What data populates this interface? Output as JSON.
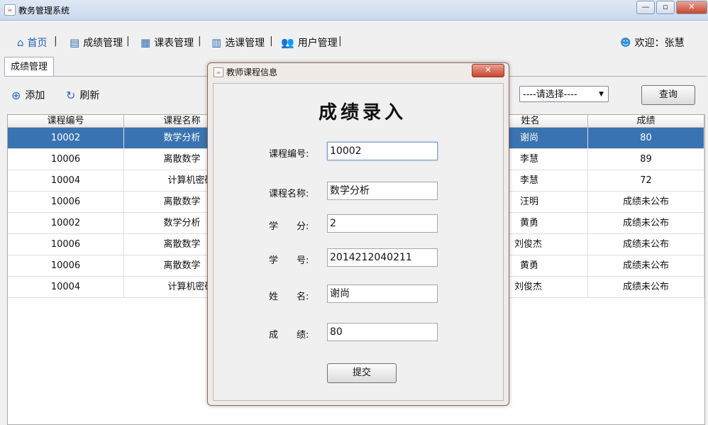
{
  "window": {
    "title": "教务管理系统"
  },
  "menu": {
    "items": [
      {
        "label": "首页",
        "icon": "home-icon"
      },
      {
        "label": "成绩管理",
        "icon": "document-icon"
      },
      {
        "label": "课表管理",
        "icon": "calendar-icon"
      },
      {
        "label": "选课管理",
        "icon": "books-icon"
      },
      {
        "label": "用户管理",
        "icon": "users-icon"
      }
    ],
    "separator": "|",
    "welcome": "欢迎：张慧"
  },
  "tabs": [
    {
      "label": "成绩管理"
    }
  ],
  "toolbar": {
    "add_label": "添加",
    "refresh_label": "刷新",
    "filter_value": "----请选择----",
    "query_label": "查询"
  },
  "table": {
    "headers": [
      "课程编号",
      "课程名称",
      "姓名",
      "成绩"
    ],
    "rows": [
      [
        "10002",
        "数学分析",
        "谢尚",
        "80"
      ],
      [
        "10006",
        "离散数学",
        "李慧",
        "89"
      ],
      [
        "10004",
        "计算机密码学",
        "李慧",
        "72"
      ],
      [
        "10006",
        "离散数学",
        "汪明",
        "成绩未公布"
      ],
      [
        "10002",
        "数学分析",
        "黄勇",
        "成绩未公布"
      ],
      [
        "10006",
        "离散数学",
        "刘俊杰",
        "成绩未公布"
      ],
      [
        "10006",
        "离散数学",
        "黄勇",
        "成绩未公布"
      ],
      [
        "10004",
        "计算机密码学",
        "刘俊杰",
        "成绩未公布"
      ]
    ],
    "selected_row": 0
  },
  "dialog": {
    "title": "教师课程信息",
    "heading": "成绩录入",
    "fields": [
      {
        "label": "课程编号:",
        "value": "10002"
      },
      {
        "label": "课程名称:",
        "value": "数学分析"
      },
      {
        "label": "学　　分:",
        "value": "2"
      },
      {
        "label": "学　　号:",
        "value": "2014212040211"
      },
      {
        "label": "姓　　名:",
        "value": "谢尚"
      },
      {
        "label": "成　　绩:",
        "value": "80"
      }
    ],
    "submit_label": "提交"
  },
  "colors": {
    "selection": "#3a73b1",
    "accent": "#2f6db5"
  }
}
